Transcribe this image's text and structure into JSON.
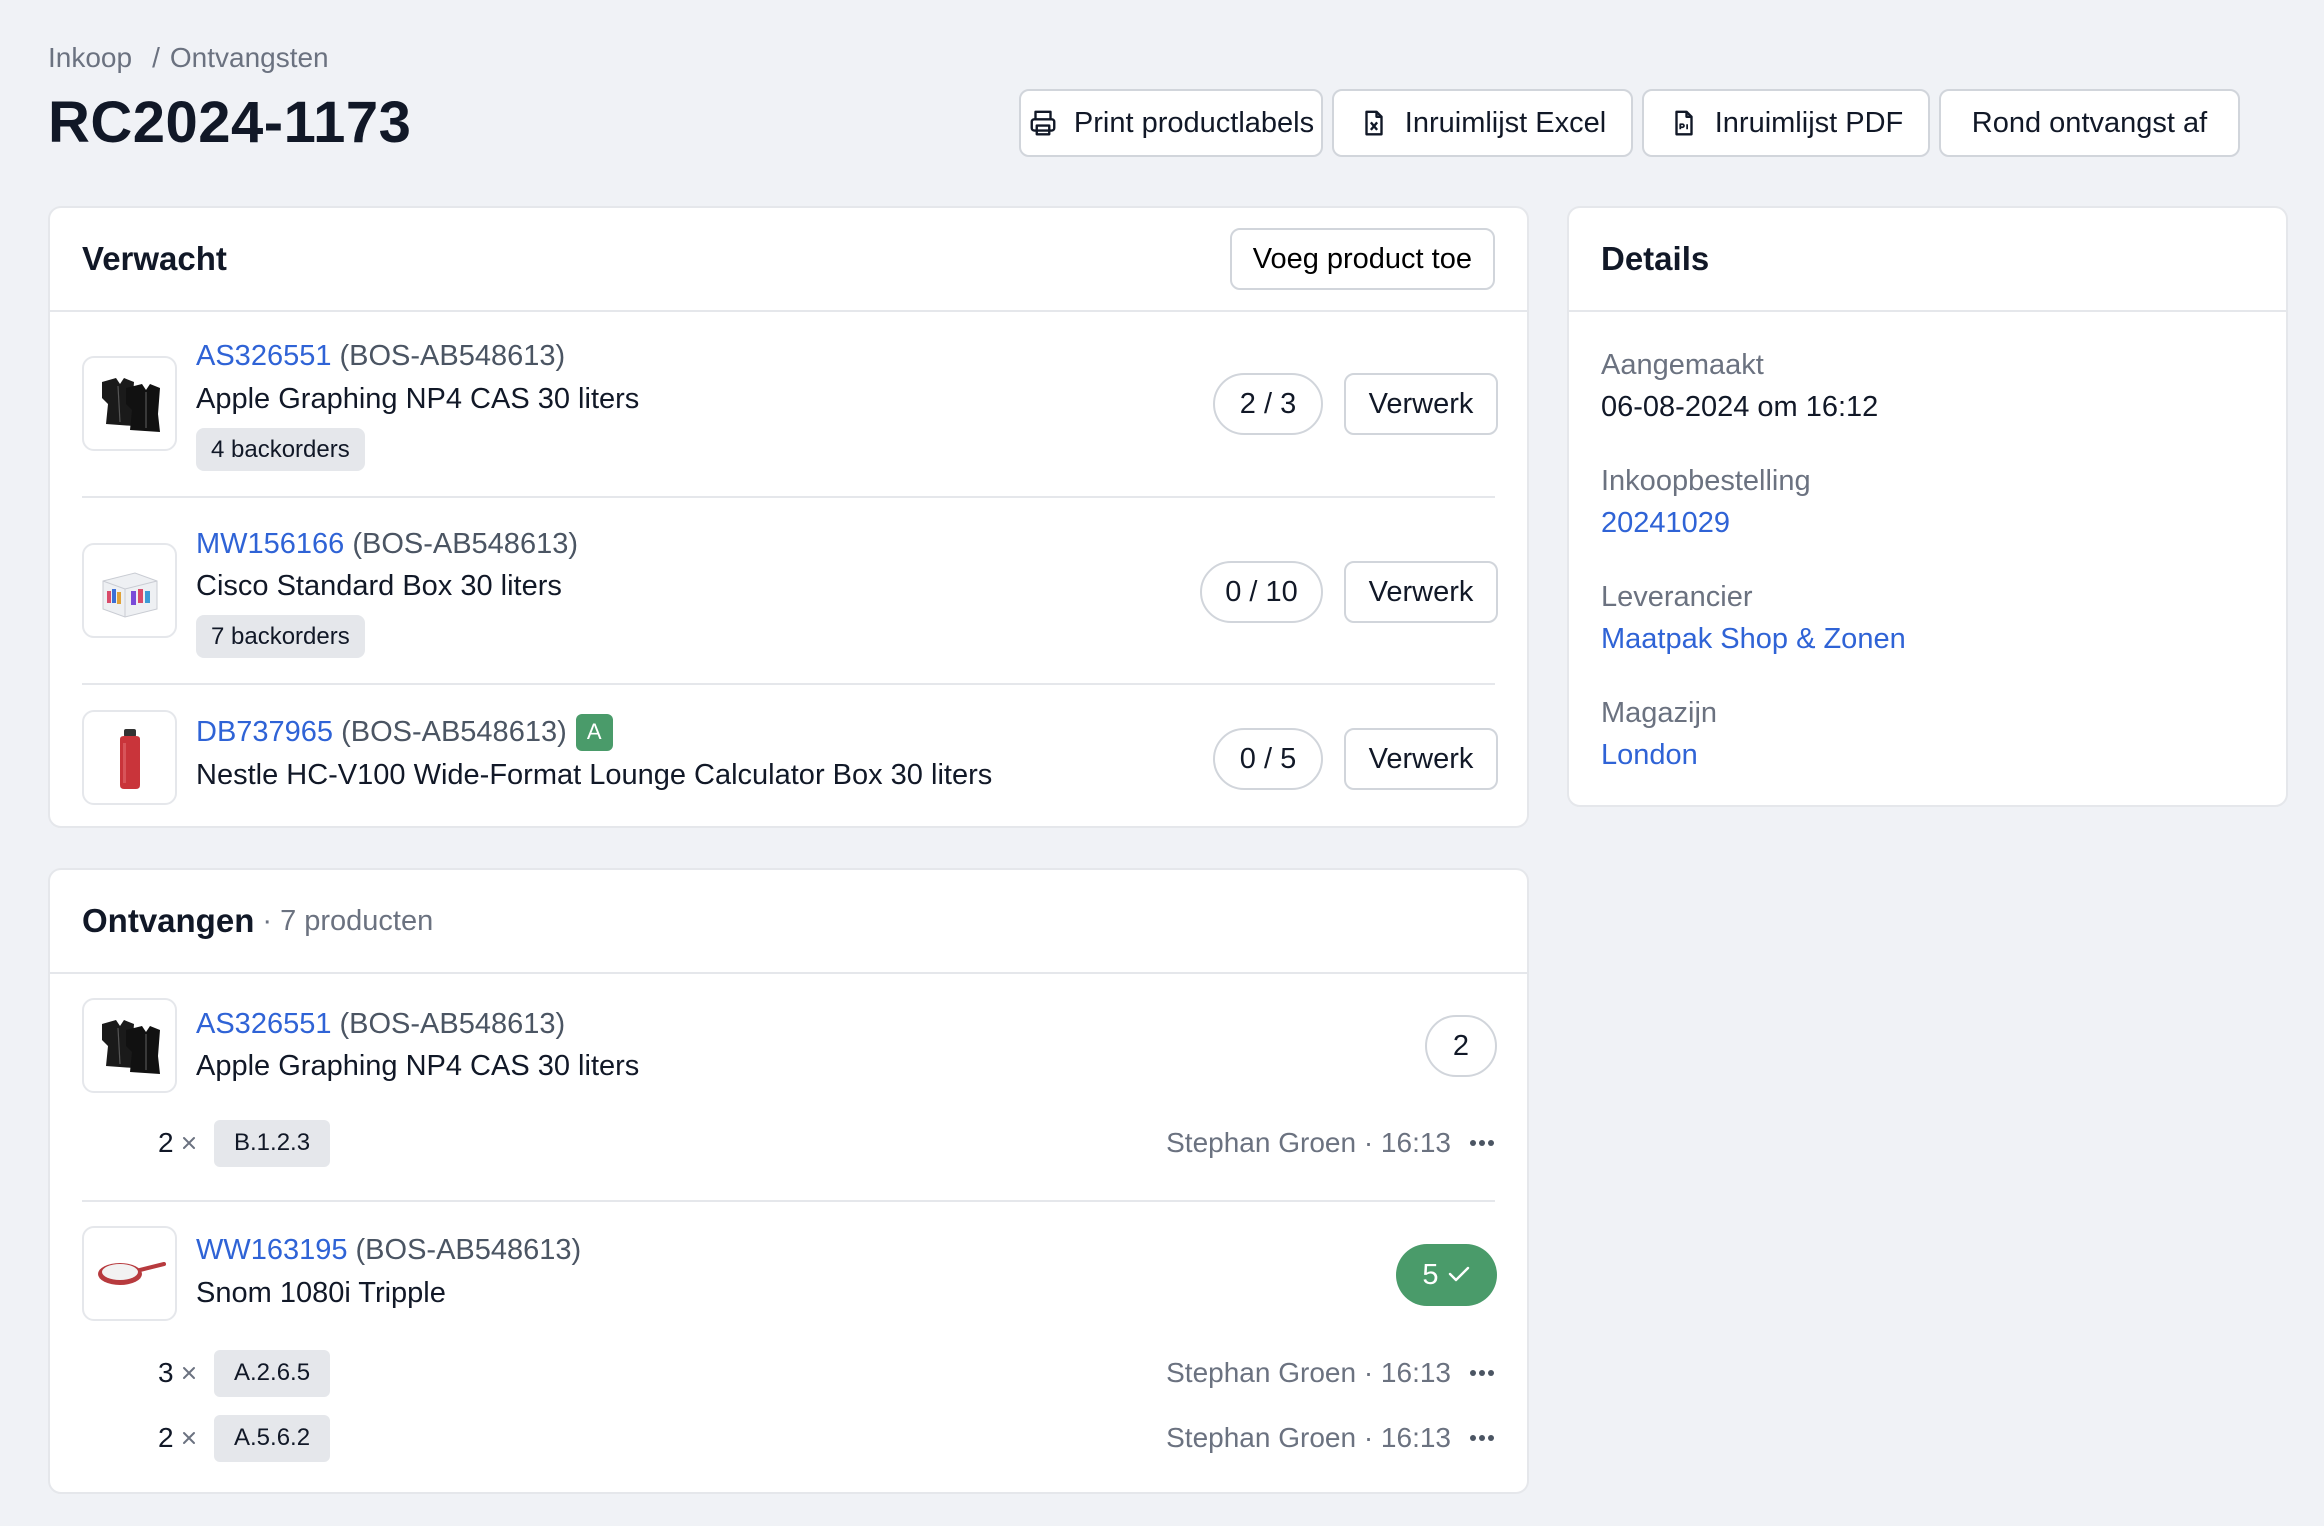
{
  "breadcrumb": {
    "items": [
      "Inkoop",
      "Ontvangsten"
    ],
    "separator": "/"
  },
  "page": {
    "title": "RC2024-1173"
  },
  "actions": [
    {
      "label": "Print productlabels",
      "icon": "printer-icon"
    },
    {
      "label": "Inruimlijst Excel",
      "icon": "excel-file-icon"
    },
    {
      "label": "Inruimlijst PDF",
      "icon": "pdf-file-icon"
    },
    {
      "label": "Rond ontvangst af"
    }
  ],
  "expected": {
    "title": "Verwacht",
    "add_label": "Voeg product toe",
    "process_label": "Verwerk",
    "items": [
      {
        "sku": "AS326551",
        "ref": "(BOS-AB548613)",
        "name": "Apple Graphing NP4 CAS 30 liters",
        "backorders": "4 backorders",
        "qty": "2 / 3",
        "thumb": "jackets-thumbnail"
      },
      {
        "sku": "MW156166",
        "ref": "(BOS-AB548613)",
        "name": "Cisco Standard Box 30 liters",
        "backorders": "7 backorders",
        "qty": "0 / 10",
        "thumb": "box-thumbnail"
      },
      {
        "sku": "DB737965",
        "ref": "(BOS-AB548613)",
        "badge": "A",
        "name": "Nestle HC-V100 Wide-Format Lounge Calculator Box 30 liters",
        "qty": "0 / 5",
        "thumb": "bottle-thumbnail"
      }
    ]
  },
  "received": {
    "title": "Ontvangen",
    "subtitle": "· 7 producten",
    "items": [
      {
        "sku": "AS326551",
        "ref": "(BOS-AB548613)",
        "name": "Apple Graphing NP4 CAS 30 liters",
        "count": "2",
        "complete": false,
        "thumb": "jackets-thumbnail",
        "locations": [
          {
            "qty": "2",
            "location": "B.1.2.3",
            "meta": "Stephan Groen · 16:13"
          }
        ]
      },
      {
        "sku": "WW163195",
        "ref": "(BOS-AB548613)",
        "name": "Snom 1080i Tripple",
        "count": "5",
        "complete": true,
        "thumb": "pan-thumbnail",
        "locations": [
          {
            "qty": "3",
            "location": "A.2.6.5",
            "meta": "Stephan Groen · 16:13"
          },
          {
            "qty": "2",
            "location": "A.5.6.2",
            "meta": "Stephan Groen · 16:13"
          }
        ]
      }
    ]
  },
  "details": {
    "title": "Details",
    "fields": [
      {
        "label": "Aangemaakt",
        "value": "06-08-2024 om 16:12",
        "link": false
      },
      {
        "label": "Inkoopbestelling",
        "value": "20241029",
        "link": true
      },
      {
        "label": "Leverancier",
        "value": "Maatpak Shop & Zonen",
        "link": true
      },
      {
        "label": "Magazijn",
        "value": "London",
        "link": true
      }
    ]
  },
  "colors": {
    "link": "#2f63d6",
    "success": "#4a9b6a",
    "background": "#f0f2f6",
    "border": "#d1d5db"
  }
}
